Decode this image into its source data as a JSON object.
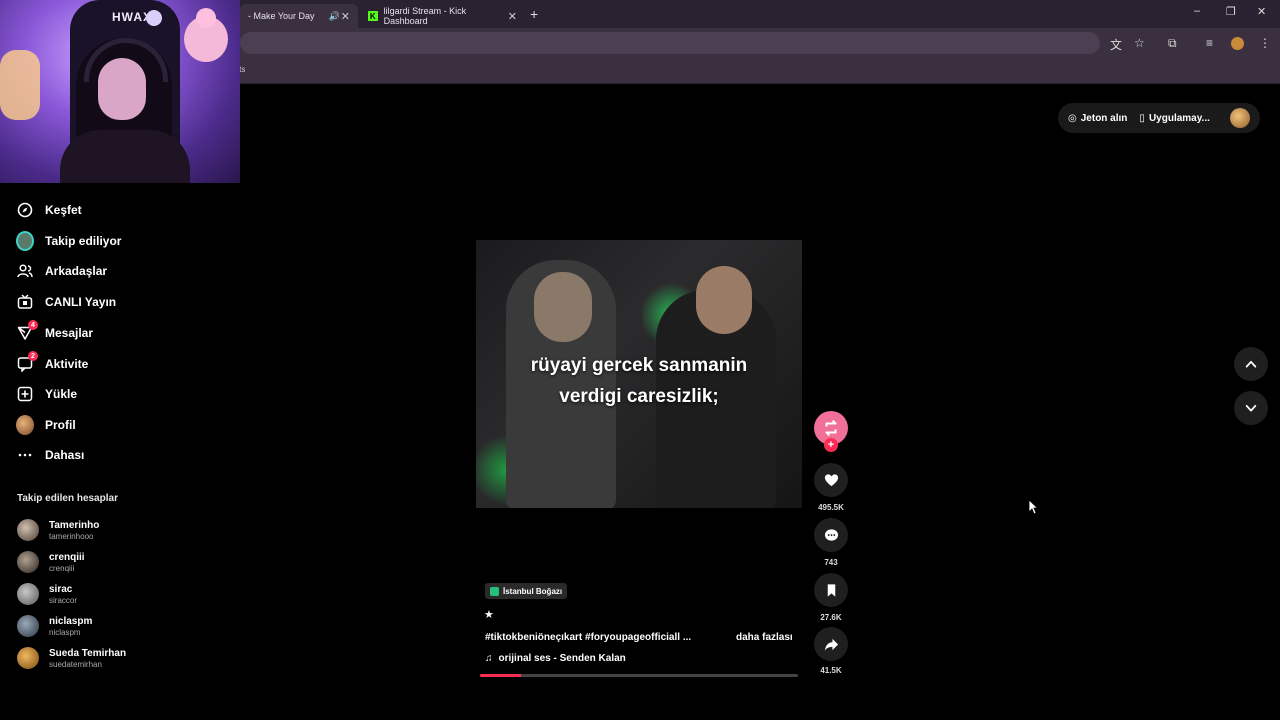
{
  "browser": {
    "tabs": [
      {
        "label": "- Make Your Day"
      },
      {
        "label": "lilgardi Stream - Kick Dashboard"
      }
    ],
    "new_tab": "+",
    "bookmarks_text": "orts",
    "window_controls": [
      "–",
      "❐",
      "✕"
    ]
  },
  "webcam": {
    "label": "HWAX"
  },
  "sidebar": {
    "items": [
      {
        "label": "Keşfet",
        "icon": "compass-icon"
      },
      {
        "label": "Takip ediliyor",
        "icon": "following-avatar"
      },
      {
        "label": "Arkadaşlar",
        "icon": "friends-icon"
      },
      {
        "label": "CANLI Yayın",
        "icon": "live-icon"
      },
      {
        "label": "Mesajlar",
        "icon": "messages-icon",
        "badge": "4"
      },
      {
        "label": "Aktivite",
        "icon": "activity-icon",
        "badge": "2"
      },
      {
        "label": "Yükle",
        "icon": "upload-icon"
      },
      {
        "label": "Profil",
        "icon": "profile-avatar"
      },
      {
        "label": "Dahası",
        "icon": "more-icon"
      }
    ],
    "followed_title": "Takip edilen hesaplar",
    "accounts": [
      {
        "name": "Tamerinho",
        "username": "tamerinhooo"
      },
      {
        "name": "crenqiii",
        "username": "crenqiii"
      },
      {
        "name": "sirac",
        "username": "siraccor"
      },
      {
        "name": "niclaspm",
        "username": "niclaspm"
      },
      {
        "name": "Sueda Temirhan",
        "username": "suedatemirhan"
      }
    ]
  },
  "header": {
    "coins_label": "Jeton alın",
    "app_label": "Uygulamay..."
  },
  "video": {
    "caption_line1": "rüyayi gercek sanmanin",
    "caption_line2": "verdigi caresizlik;",
    "location": "İstanbul Boğazı",
    "star": "★",
    "hashtags": "#tiktokbeniöneçıkart #foryoupageofficiall ...",
    "more_label": "daha fazlası",
    "music": "orijinal ses - Senden Kalan",
    "progress": 0.13
  },
  "actions": {
    "likes": "495.5K",
    "comments": "743",
    "saves": "27.6K",
    "shares": "41.5K"
  },
  "colors": {
    "accent": "#fe2c55",
    "panel": "#1f1f1f"
  }
}
